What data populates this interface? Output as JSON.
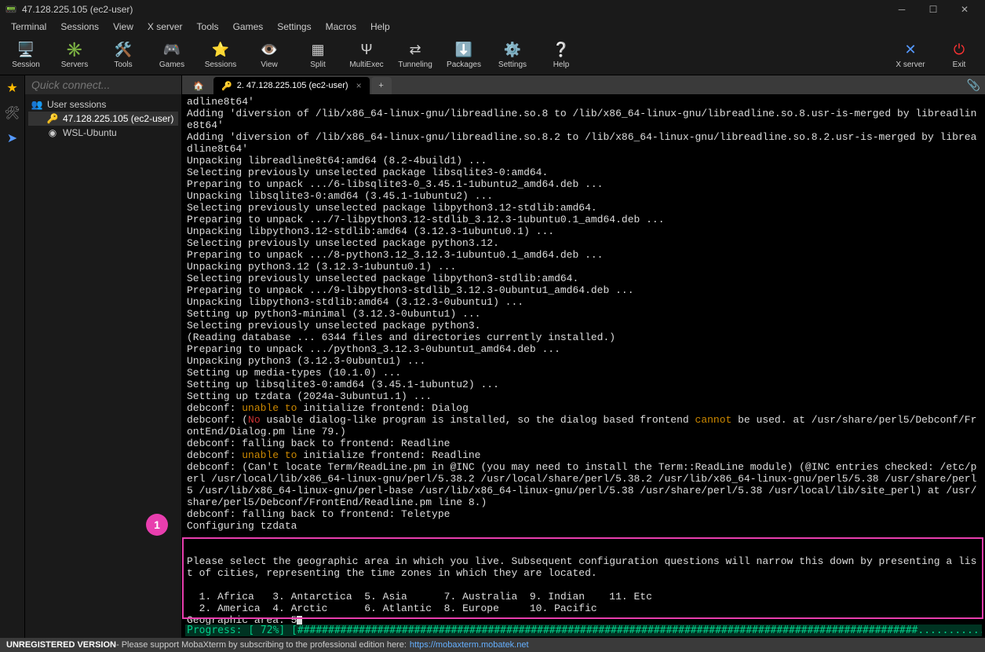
{
  "window": {
    "title": "47.128.225.105 (ec2-user)"
  },
  "menubar": [
    "Terminal",
    "Sessions",
    "View",
    "X server",
    "Tools",
    "Games",
    "Settings",
    "Macros",
    "Help"
  ],
  "toolbar": [
    {
      "label": "Session",
      "icon": "🖥️"
    },
    {
      "label": "Servers",
      "icon": "✳️"
    },
    {
      "label": "Tools",
      "icon": "🛠️"
    },
    {
      "label": "Games",
      "icon": "🎮"
    },
    {
      "label": "Sessions",
      "icon": "⭐"
    },
    {
      "label": "View",
      "icon": "👁️"
    },
    {
      "label": "Split",
      "icon": "▦"
    },
    {
      "label": "MultiExec",
      "icon": "Ψ"
    },
    {
      "label": "Tunneling",
      "icon": "⇄"
    },
    {
      "label": "Packages",
      "icon": "⬇️"
    },
    {
      "label": "Settings",
      "icon": "⚙️"
    },
    {
      "label": "Help",
      "icon": "❔"
    }
  ],
  "toolbar_right": [
    {
      "label": "X server",
      "icon": "✕"
    },
    {
      "label": "Exit",
      "icon": "⏻"
    }
  ],
  "quick_connect_placeholder": "Quick connect...",
  "sidebar": {
    "root": "User sessions",
    "items": [
      {
        "label": "47.128.225.105 (ec2-user)",
        "active": true,
        "icon": "🔑"
      },
      {
        "label": "WSL-Ubuntu",
        "active": false,
        "icon": "◉"
      }
    ]
  },
  "tabs": {
    "active_label": "2. 47.128.225.105 (ec2-user)",
    "close_x": "×",
    "plus": "+"
  },
  "terminal_lines": [
    "adline8t64'",
    "Adding 'diversion of /lib/x86_64-linux-gnu/libreadline.so.8 to /lib/x86_64-linux-gnu/libreadline.so.8.usr-is-merged by libreadline8t64'",
    "Adding 'diversion of /lib/x86_64-linux-gnu/libreadline.so.8.2 to /lib/x86_64-linux-gnu/libreadline.so.8.2.usr-is-merged by libreadline8t64'",
    "Unpacking libreadline8t64:amd64 (8.2-4build1) ...",
    "Selecting previously unselected package libsqlite3-0:amd64.",
    "Preparing to unpack .../6-libsqlite3-0_3.45.1-1ubuntu2_amd64.deb ...",
    "Unpacking libsqlite3-0:amd64 (3.45.1-1ubuntu2) ...",
    "Selecting previously unselected package libpython3.12-stdlib:amd64.",
    "Preparing to unpack .../7-libpython3.12-stdlib_3.12.3-1ubuntu0.1_amd64.deb ...",
    "Unpacking libpython3.12-stdlib:amd64 (3.12.3-1ubuntu0.1) ...",
    "Selecting previously unselected package python3.12.",
    "Preparing to unpack .../8-python3.12_3.12.3-1ubuntu0.1_amd64.deb ...",
    "Unpacking python3.12 (3.12.3-1ubuntu0.1) ...",
    "Selecting previously unselected package libpython3-stdlib:amd64.",
    "Preparing to unpack .../9-libpython3-stdlib_3.12.3-0ubuntu1_amd64.deb ...",
    "Unpacking libpython3-stdlib:amd64 (3.12.3-0ubuntu1) ...",
    "Setting up python3-minimal (3.12.3-0ubuntu1) ...",
    "Selecting previously unselected package python3.",
    "(Reading database ... 6344 files and directories currently installed.)",
    "Preparing to unpack .../python3_3.12.3-0ubuntu1_amd64.deb ...",
    "Unpacking python3 (3.12.3-0ubuntu1) ...",
    "Setting up media-types (10.1.0) ...",
    "Setting up libsqlite3-0:amd64 (3.45.1-1ubuntu2) ...",
    "Setting up tzdata (2024a-3ubuntu1.1) ..."
  ],
  "debconf": {
    "l1a": "debconf: ",
    "l1b": "unable to",
    "l1c": " initialize frontend: Dialog",
    "l2a": "debconf: (",
    "l2b": "No",
    "l2c": " usable dialog-like program is installed, so the dialog based frontend ",
    "l2d": "cannot",
    "l2e": " be used. at /usr/share/perl5/Debconf/FrontEnd/Dialog.pm line 79.)",
    "l3": "debconf: falling back to frontend: Readline",
    "l4a": "debconf: ",
    "l4b": "unable to",
    "l4c": " initialize frontend: Readline",
    "l5": "debconf: (Can't locate Term/ReadLine.pm in @INC (you may need to install the Term::ReadLine module) (@INC entries checked: /etc/perl /usr/local/lib/x86_64-linux-gnu/perl/5.38.2 /usr/local/share/perl/5.38.2 /usr/lib/x86_64-linux-gnu/perl5/5.38 /usr/share/perl5 /usr/lib/x86_64-linux-gnu/perl-base /usr/lib/x86_64-linux-gnu/perl/5.38 /usr/share/perl/5.38 /usr/local/lib/site_perl) at /usr/share/perl5/Debconf/FrontEnd/Readline.pm line 8.)",
    "l6": "debconf: falling back to frontend: Teletype",
    "l7": "Configuring tzdata",
    "l8": "------------------"
  },
  "prompt": {
    "intro": "Please select the geographic area in which you live. Subsequent configuration questions will narrow this down by presenting a list of cities, representing the time zones in which they are located.",
    "row1": "  1. Africa   3. Antarctica  5. Asia      7. Australia  9. Indian    11. Etc",
    "row2": "  2. America  4. Arctic      6. Atlantic  8. Europe     10. Pacific",
    "question": "Geographic area: ",
    "answer": "5"
  },
  "progress": "Progress: [ 72%] [#####################################################################################################.........................................]",
  "highlight_badge": "1",
  "statusbar": {
    "bold": "UNREGISTERED VERSION",
    "text": " - Please support MobaXterm by subscribing to the professional edition here: ",
    "link": "https://mobaxterm.mobatek.net"
  }
}
